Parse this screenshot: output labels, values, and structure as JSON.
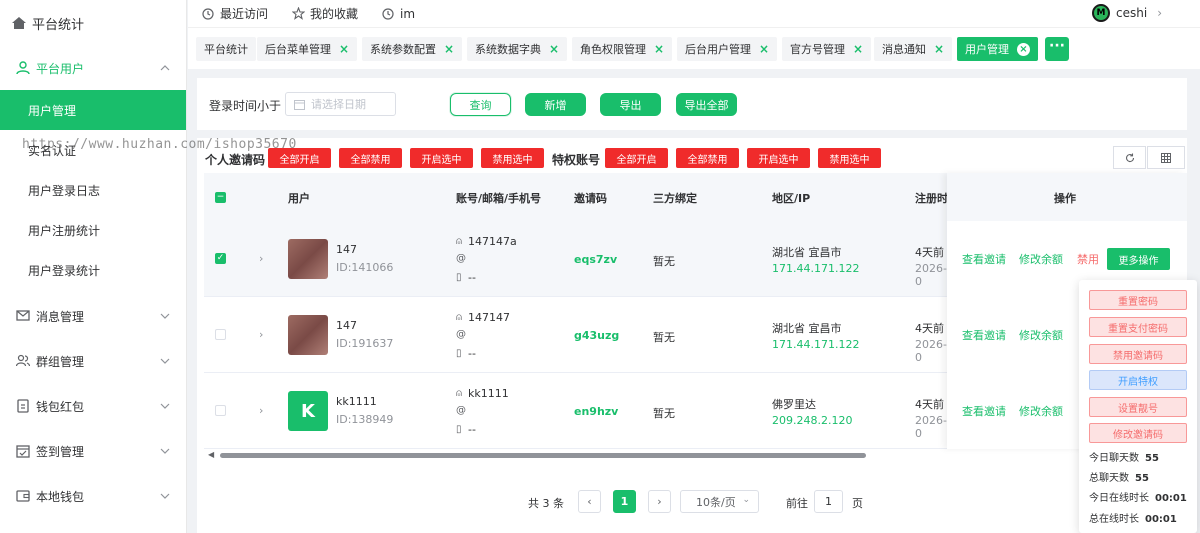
{
  "sidebar": {
    "brand": "平台统计",
    "groups": [
      {
        "label": "平台用户",
        "icon": "people-icon"
      },
      {
        "label": "消息管理",
        "icon": "message-icon"
      },
      {
        "label": "群组管理",
        "icon": "group-icon"
      },
      {
        "label": "钱包红包",
        "icon": "wallet-icon"
      },
      {
        "label": "签到管理",
        "icon": "calendar-icon"
      },
      {
        "label": "本地钱包",
        "icon": "local-wallet-icon"
      }
    ],
    "sub_items": [
      "用户管理",
      "实名认证",
      "用户登录日志",
      "用户注册统计",
      "用户登录统计"
    ]
  },
  "topbar": {
    "recent": "最近访问",
    "favorites": "我的收藏",
    "im": "im",
    "user": "ceshi",
    "avatar_letter": "M"
  },
  "tabs": [
    "平台统计",
    "后台菜单管理",
    "系统参数配置",
    "系统数据字典",
    "角色权限管理",
    "后台用户管理",
    "官方号管理",
    "消息通知",
    "用户管理"
  ],
  "tab_more": "···",
  "search": {
    "label": "登录时间小于",
    "date_placeholder": "请选择日期",
    "query": "查询",
    "add": "新增",
    "export": "导出",
    "export_all": "导出全部"
  },
  "watermark": "https://www.huzhan.com/ishop35670",
  "toolbar": {
    "personal_label": "个人邀请码",
    "privileged_label": "特权账号",
    "enable_all": "全部开启",
    "disable_all": "全部禁用",
    "enable_selected": "开启选中",
    "disable_selected": "禁用选中"
  },
  "table": {
    "headers": {
      "user": "用户",
      "account": "账号/邮箱/手机号",
      "invite": "邀请码",
      "bind": "三方绑定",
      "region": "地区/IP",
      "register": "注册时",
      "ops": "操作"
    },
    "rows": [
      {
        "name": "147",
        "id": "ID:141066",
        "account": "147147a",
        "email": "",
        "phone": "--",
        "invite": "eqs7zv",
        "bind": "暂无",
        "region": "湖北省 宜昌市",
        "ip": "171.44.171.122",
        "reg": "4天前",
        "reg_date": "2026-0",
        "checked": "✓",
        "avatar_letter": ""
      },
      {
        "name": "147",
        "id": "ID:191637",
        "account": "147147",
        "email": "",
        "phone": "--",
        "invite": "g43uzg",
        "bind": "暂无",
        "region": "湖北省 宜昌市",
        "ip": "171.44.171.122",
        "reg": "4天前",
        "reg_date": "2026-0",
        "checked": "",
        "avatar_letter": ""
      },
      {
        "name": "kk1111",
        "id": "ID:138949",
        "account": "kk1111",
        "email": "",
        "phone": "--",
        "invite": "en9hzv",
        "bind": "暂无",
        "region": "佛罗里达",
        "ip": "209.248.2.120",
        "reg": "4天前",
        "reg_date": "2026-0",
        "checked": "",
        "avatar_letter": "K"
      }
    ],
    "ops": {
      "view_invite": "查看邀请",
      "edit_balance": "修改余额",
      "disable": "禁用",
      "more": "更多操作"
    }
  },
  "dropdown": {
    "reset_password": "重置密码",
    "reset_pay_password": "重置支付密码",
    "disable_invite": "禁用邀请码",
    "enable_privilege": "开启特权",
    "set_pretty_id": "设置靓号",
    "edit_invite": "修改邀请码",
    "stats": [
      {
        "label": "今日聊天数",
        "value": "55"
      },
      {
        "label": "总聊天数",
        "value": "55"
      },
      {
        "label": "今日在线时长",
        "value": "00:01"
      },
      {
        "label": "总在线时长",
        "value": "00:01"
      }
    ]
  },
  "pagination": {
    "total": "共 3 条",
    "current": "1",
    "page_size": "10条/页",
    "goto": "前往",
    "goto_value": "1",
    "page_unit": "页",
    "prev": "‹",
    "next": "›"
  },
  "colors": {
    "accent": "#19be6b",
    "danger": "#f02b2b",
    "link_red": "#f56c6c"
  }
}
